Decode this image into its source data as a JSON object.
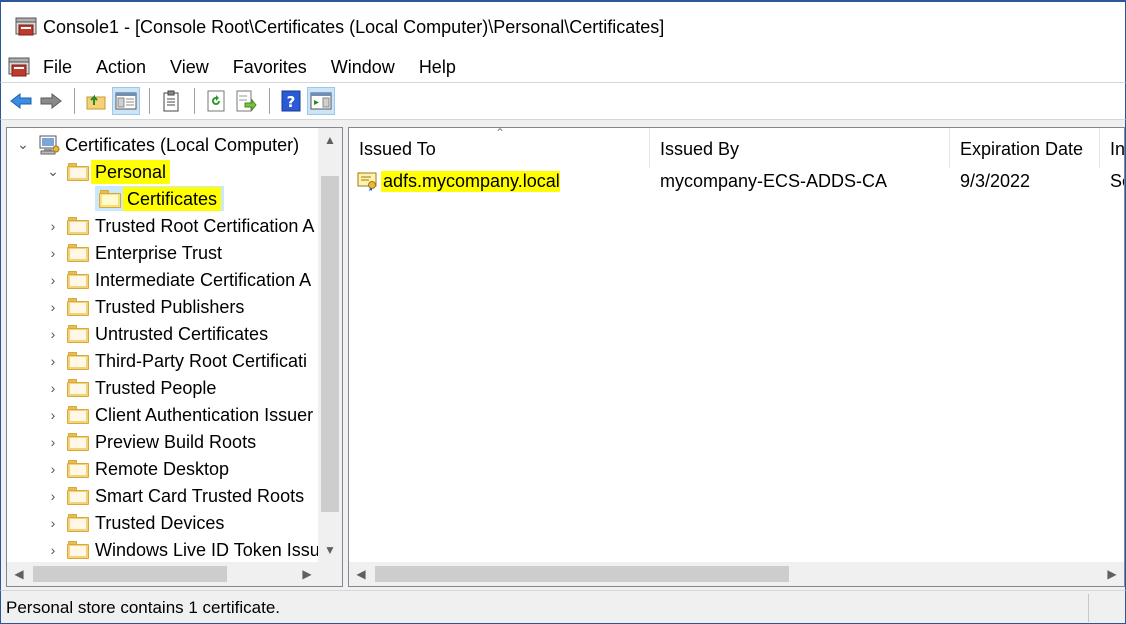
{
  "window": {
    "title": "Console1 - [Console Root\\Certificates (Local Computer)\\Personal\\Certificates]"
  },
  "menu": {
    "items": [
      "File",
      "Action",
      "View",
      "Favorites",
      "Window",
      "Help"
    ]
  },
  "toolbar": {
    "buttons": [
      "back-icon",
      "forward-icon",
      "up-folder-icon",
      "show-hide-tree-icon",
      "clipboard-icon",
      "refresh-icon",
      "export-list-icon",
      "help-icon",
      "show-action-pane-icon"
    ]
  },
  "tree": {
    "root": "Certificates (Local Computer)",
    "items": [
      "Personal",
      "Certificates",
      "Trusted Root Certification A",
      "Enterprise Trust",
      "Intermediate Certification A",
      "Trusted Publishers",
      "Untrusted Certificates",
      "Third-Party Root Certificati",
      "Trusted People",
      "Client Authentication Issuer",
      "Preview Build Roots",
      "Remote Desktop",
      "Smart Card Trusted Roots",
      "Trusted Devices",
      "Windows Live ID Token Issu"
    ]
  },
  "list": {
    "columns": [
      "Issued To",
      "Issued By",
      "Expiration Date",
      "In"
    ],
    "rows": [
      {
        "issued_to": "adfs.mycompany.local",
        "issued_by": "mycompany-ECS-ADDS-CA",
        "expiration": "9/3/2022",
        "intended": "Se"
      }
    ]
  },
  "status": {
    "text": "Personal store contains 1 certificate."
  },
  "colors": {
    "highlight": "#ffff00",
    "selection": "#cce8ff",
    "folder": "#f5d27a"
  }
}
